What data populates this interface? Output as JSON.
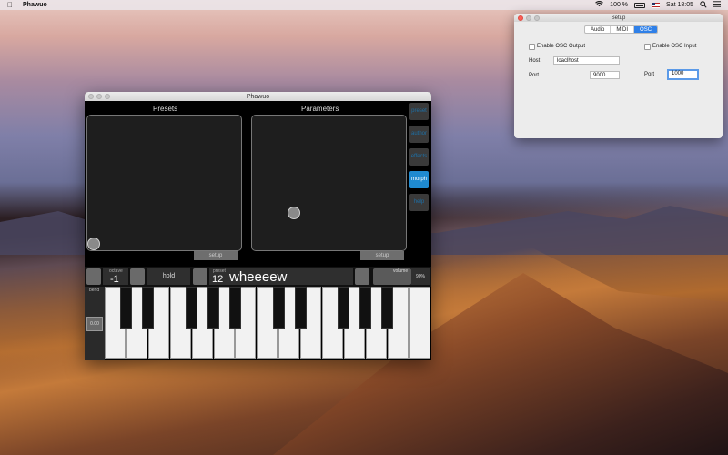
{
  "menubar": {
    "app_name": "Phawuo",
    "battery": "100 %",
    "clock": "Sat 18:05",
    "icons": [
      "apple-icon",
      "wifi-icon",
      "battery-icon",
      "flag-icon",
      "search-icon",
      "list-icon"
    ]
  },
  "phawuo": {
    "title": "Phawuo",
    "presets_title": "Presets",
    "parameters_title": "Parameters",
    "setup_left": "setup",
    "setup_right": "setup",
    "side_buttons": [
      "preset",
      "author",
      "effects",
      "morph",
      "help"
    ],
    "active_side": "morph",
    "octave_label": "octave",
    "octave_value": "-1",
    "hold_label": "hold",
    "preset_label": "preset",
    "preset_number": "12",
    "preset_name": "wheeeew",
    "volume_label": "volume",
    "volume_value": "90%",
    "bend_label": "bend",
    "bend_value": "0.00"
  },
  "setup": {
    "title": "Setup",
    "tabs": [
      "Audio",
      "MIDI",
      "OSC"
    ],
    "selected_tab": "OSC",
    "enable_output": "Enable OSC Output",
    "enable_input": "Enable OSC Input",
    "host_label": "Host",
    "host_value": "loaclhost",
    "port_out_label": "Port",
    "port_out_value": "9000",
    "port_in_label": "Port",
    "port_in_value": "1000"
  }
}
